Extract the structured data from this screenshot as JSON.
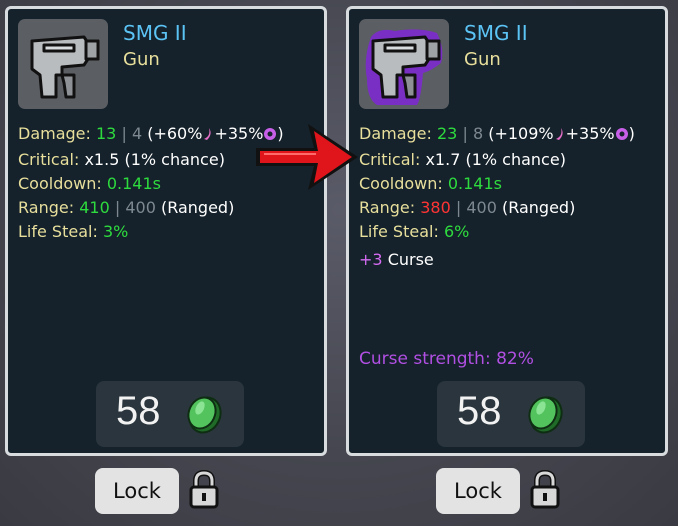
{
  "left_card": {
    "name": "SMG II",
    "type": "Gun",
    "stats": {
      "damage_label": "Damage:",
      "damage_value": "13",
      "damage_sep": "|",
      "damage_base": "4",
      "damage_scaling_open": "(+60%",
      "damage_scaling_mid": "+35%",
      "damage_scaling_close": ")",
      "critical_label": "Critical:",
      "critical_value": "x1.5 (1% chance)",
      "cooldown_label": "Cooldown:",
      "cooldown_value": "0.141s",
      "range_label": "Range:",
      "range_value": "410",
      "range_sep": "|",
      "range_base": "400",
      "range_kind": "(Ranged)",
      "lifesteal_label": "Life Steal:",
      "lifesteal_value": "3%"
    },
    "price": "58",
    "lock_label": "Lock"
  },
  "right_card": {
    "name": "SMG II",
    "type": "Gun",
    "stats": {
      "damage_label": "Damage:",
      "damage_value": "23",
      "damage_sep": "|",
      "damage_base": "8",
      "damage_scaling_open": "(+109%",
      "damage_scaling_mid": "+35%",
      "damage_scaling_close": ")",
      "critical_label": "Critical:",
      "critical_value": "x1.7 (1% chance)",
      "cooldown_label": "Cooldown:",
      "cooldown_value": "0.141s",
      "range_label": "Range:",
      "range_value": "380",
      "range_sep": "|",
      "range_base": "400",
      "range_kind": "(Ranged)",
      "lifesteal_label": "Life Steal:",
      "lifesteal_value": "6%",
      "curse_value": "+3",
      "curse_label": "Curse"
    },
    "curse_strength": "Curse strength: 82%",
    "price": "58",
    "lock_label": "Lock"
  },
  "colors": {
    "title": "#5cc3f5",
    "label": "#e8df9c",
    "positive": "#2edb3e",
    "negative": "#ff3434",
    "curse": "#b14fe3",
    "arrow": "#e0151b"
  },
  "icons": [
    "smg-icon",
    "cursed-smg-icon",
    "elemental-damage-icon",
    "engineering-icon",
    "green-coin-icon",
    "padlock-icon",
    "red-arrow-icon"
  ]
}
